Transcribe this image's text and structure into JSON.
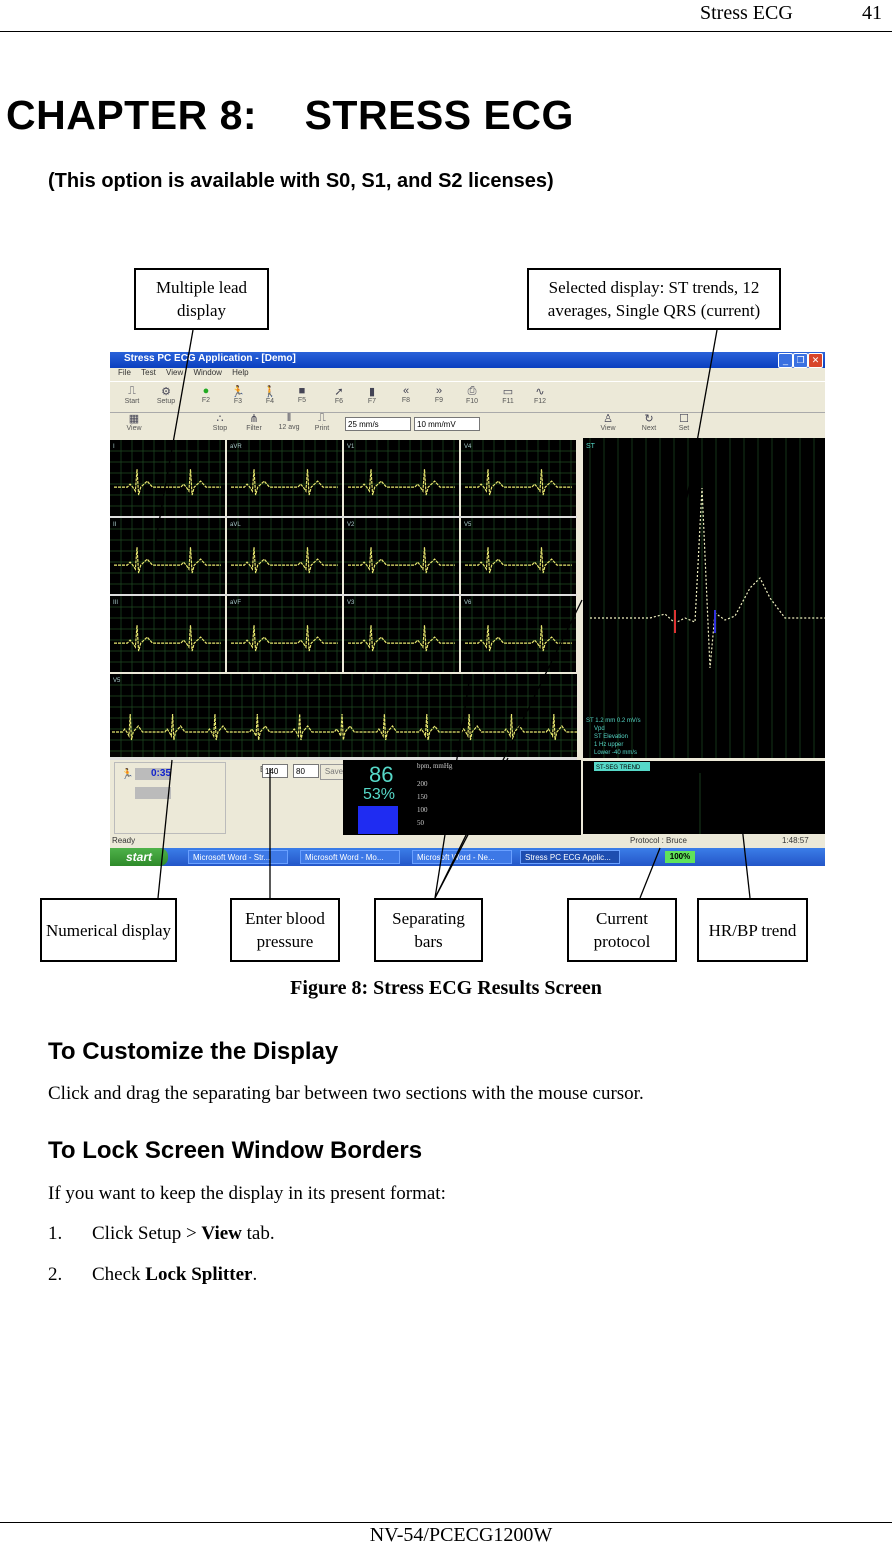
{
  "header": {
    "section_title": "Stress ECG",
    "page_number": "41"
  },
  "chapter": {
    "title": "CHAPTER 8:    STRESS ECG",
    "subtitle": "(This option is available with S0, S1, and S2 licenses)"
  },
  "figure": {
    "caption": "Figure 8: Stress ECG Results Screen",
    "callouts": {
      "multiple_lead": "Multiple lead display",
      "selected_display": "Selected display: ST trends, 12 averages, Single QRS (current)",
      "numerical": "Numerical display",
      "blood_pressure": "Enter blood pressure",
      "separating_bars": "Separating bars",
      "current_protocol": "Current protocol",
      "hr_bp_trend": "HR/BP trend"
    },
    "screenshot": {
      "window_title": "Stress PC ECG Application - [Demo]",
      "menu": [
        "File",
        "Test",
        "View",
        "Window",
        "Help"
      ],
      "toolbar": [
        "Start",
        "Setup",
        "F2",
        "F3",
        "F4",
        "F5",
        "F6",
        "F7",
        "F8",
        "F9",
        "F10",
        "F11",
        "F12"
      ],
      "toolbar2": [
        "View",
        "Stop",
        "Filter",
        "12 avg",
        "Print"
      ],
      "speed_select": "25 mm/s",
      "gain_select": "10 mm/mV",
      "right_toolbar": [
        "View",
        "Next",
        "Set"
      ],
      "lead_labels": [
        "I",
        "aVR",
        "V1",
        "V4",
        "II",
        "aVL",
        "V2",
        "V5",
        "III",
        "aVF",
        "V3",
        "V6",
        "V5"
      ],
      "stage_time": "0:35",
      "bp_label": "BP",
      "bp_sys": "140",
      "bp_dia": "80",
      "bp_button": "Save",
      "heart_rate": "86",
      "target_percent": "53%",
      "hr_scale": [
        "200",
        "150",
        "100",
        "50"
      ],
      "hr_axis_label": "bpm, mmHg",
      "st_box_label": "ST",
      "st_legend": [
        "ST 1.2 mm 0.2 mV/s",
        "Vpd",
        "ST Elevation",
        "1 Hz upper",
        "Lower -40 mm/s"
      ],
      "trend_label": "ST-SEG TREND",
      "status_ready": "Ready",
      "protocol_status": "Protocol : Bruce",
      "clock": "1:48:57",
      "taskbar_start": "start",
      "taskbar_items": [
        "Microsoft Word - Str...",
        "Microsoft Word - Mo...",
        "Microsoft Word - Ne...",
        "Stress PC ECG Applic..."
      ],
      "battery": "100%"
    }
  },
  "sections": [
    {
      "heading": "To Customize the Display",
      "paragraphs": [
        "Click and drag the separating bar between two sections with the mouse cursor."
      ]
    },
    {
      "heading": "To Lock Screen Window Borders",
      "paragraphs": [
        "If you want to keep the display in its present format:"
      ],
      "steps": [
        {
          "num": "1.",
          "pre": "Click Setup > ",
          "bold": "View",
          "post": " tab."
        },
        {
          "num": "2.",
          "pre": "Check ",
          "bold": "Lock Splitter",
          "post": "."
        }
      ]
    }
  ],
  "footer": {
    "doc_id": "NV-54/PCECG1200W"
  }
}
